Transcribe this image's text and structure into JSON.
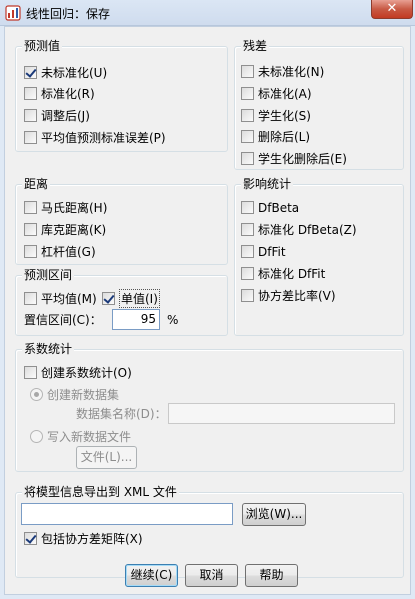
{
  "window": {
    "title": "线性回归：保存",
    "close_label": "✕"
  },
  "predicted": {
    "title": "预测值",
    "items": [
      {
        "label": "未标准化(U)",
        "checked": true
      },
      {
        "label": "标准化(R)",
        "checked": false
      },
      {
        "label": "调整后(J)",
        "checked": false
      },
      {
        "label": "平均值预测标准误差(P)",
        "checked": false
      }
    ]
  },
  "residuals": {
    "title": "残差",
    "items": [
      {
        "label": "未标准化(N)",
        "checked": false
      },
      {
        "label": "标准化(A)",
        "checked": false
      },
      {
        "label": "学生化(S)",
        "checked": false
      },
      {
        "label": "删除后(L)",
        "checked": false
      },
      {
        "label": "学生化删除后(E)",
        "checked": false
      }
    ]
  },
  "distances": {
    "title": "距离",
    "items": [
      {
        "label": "马氏距离(H)",
        "checked": false
      },
      {
        "label": "库克距离(K)",
        "checked": false
      },
      {
        "label": "杠杆值(G)",
        "checked": false
      }
    ]
  },
  "influence": {
    "title": "影响统计",
    "items": [
      {
        "label": "DfBeta",
        "checked": false
      },
      {
        "label": "标准化 DfBeta(Z)",
        "checked": false
      },
      {
        "label": "DfFit",
        "checked": false
      },
      {
        "label": "标准化 DfFit",
        "checked": false
      },
      {
        "label": "协方差比率(V)",
        "checked": false
      }
    ]
  },
  "prediction_intervals": {
    "title": "预测区间",
    "mean_label": "平均值(M)",
    "mean_checked": false,
    "individual_label": "单值(I)",
    "individual_checked": true,
    "confidence_label": "置信区间(C)：",
    "confidence_value": "95",
    "percent_sign": "%"
  },
  "coefficients": {
    "title": "系数统计",
    "create_label": "创建系数统计(O)",
    "create_checked": false,
    "new_dataset_label": "创建新数据集",
    "dataset_name_label": "数据集名称(D)：",
    "dataset_name_value": "",
    "write_file_label": "写入新数据文件",
    "file_button": "文件(L)..."
  },
  "export": {
    "title": "将模型信息导出到 XML 文件",
    "path_value": "",
    "browse_button": "浏览(W)...",
    "include_cov_label": "包括协方差矩阵(X)",
    "include_cov_checked": true
  },
  "buttons": {
    "continue": "继续(C)",
    "cancel": "取消",
    "help": "帮助"
  }
}
